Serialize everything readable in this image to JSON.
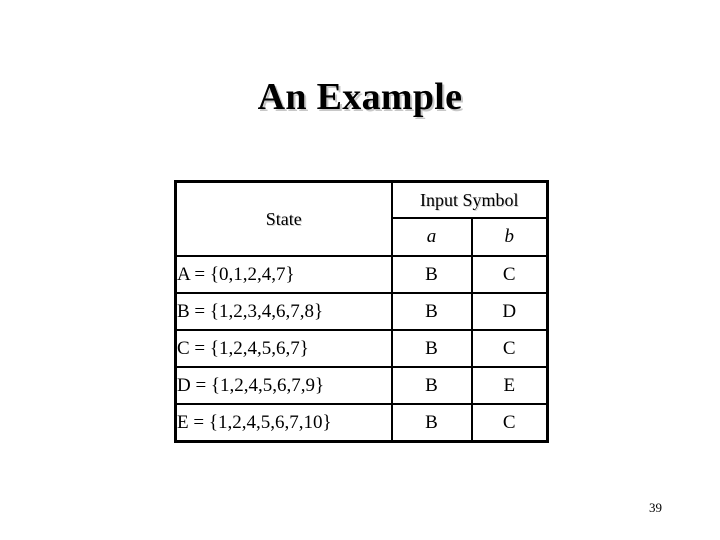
{
  "slide": {
    "title": "An Example",
    "page_number": "39",
    "background_color": "#ffffff",
    "text_color": "#000000",
    "title_shadow_color": "#c8c8c8"
  },
  "table": {
    "headers": {
      "state": "State",
      "input_symbol": "Input Symbol",
      "symbol_a": "a",
      "symbol_b": "b"
    },
    "rows": [
      {
        "state": "A = {0,1,2,4,7}",
        "a": "B",
        "b": "C"
      },
      {
        "state": "B = {1,2,3,4,6,7,8}",
        "a": "B",
        "b": "D"
      },
      {
        "state": "C = {1,2,4,5,6,7}",
        "a": "B",
        "b": "C"
      },
      {
        "state": "D = {1,2,4,5,6,7,9}",
        "a": "B",
        "b": "E"
      },
      {
        "state": "E = {1,2,4,5,6,7,10}",
        "a": "B",
        "b": "C"
      }
    ]
  }
}
